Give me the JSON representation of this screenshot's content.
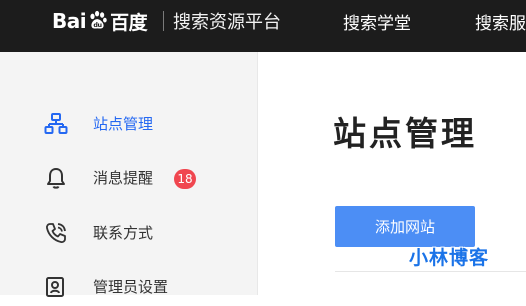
{
  "header": {
    "logo_left": "Bai",
    "logo_right": "百度",
    "platform_title": "搜索资源平台",
    "nav": [
      "搜索学堂",
      "搜索服"
    ]
  },
  "sidebar": {
    "items": [
      {
        "label": "站点管理",
        "icon": "sitemap-icon",
        "active": true
      },
      {
        "label": "消息提醒",
        "icon": "bell-icon",
        "badge": "18"
      },
      {
        "label": "联系方式",
        "icon": "phone-icon"
      },
      {
        "label": "管理员设置",
        "icon": "admin-settings-icon"
      }
    ]
  },
  "main": {
    "title": "站点管理",
    "add_button_label": "添加网站"
  },
  "watermark": "小林博客",
  "colors": {
    "topbar": "#1c1c1c",
    "sidebar": "#f4f4f4",
    "accent": "#2468f2",
    "button": "#4c8ef5",
    "badge": "#f0464f"
  }
}
